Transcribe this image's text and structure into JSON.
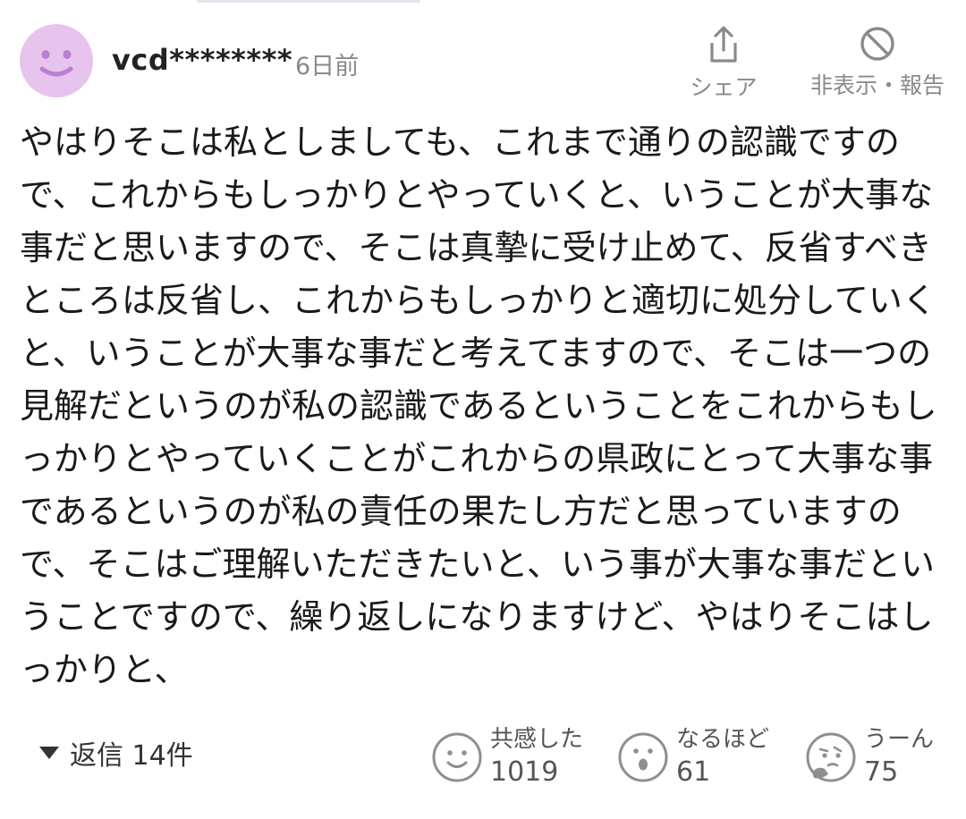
{
  "comment": {
    "username": "vcd********",
    "timestamp": "6日前",
    "body": "やはりそこは私としましても、これまで通りの認識ですので、これからもしっかりとやっていくと、いうことが大事な事だと思いますので、そこは真摯に受け止めて、反省すべきところは反省し、これからもしっかりと適切に処分していくと、いうことが大事な事だと考えてますので、そこは一つの見解だというのが私の認識であるということをこれからもしっかりとやっていくことがこれからの県政にとって大事な事であるというのが私の責任の果たし方だと思っていますので、そこはご理解いただきたいと、いう事が大事な事だということですので、繰り返しになりますけど、やはりそこはしっかりと、"
  },
  "actions": {
    "share_label": "シェア",
    "report_label": "非表示・報告"
  },
  "replies": {
    "label": "返信 14件"
  },
  "reactions": [
    {
      "label": "共感した",
      "count": "1019",
      "icon": "smile-face-icon"
    },
    {
      "label": "なるほど",
      "count": "61",
      "icon": "surprised-face-icon"
    },
    {
      "label": "うーん",
      "count": "75",
      "icon": "thinking-face-icon"
    }
  ],
  "colors": {
    "avatar_bg": "#e7c4ee",
    "avatar_face": "#b97fd0",
    "muted_text": "#8a8a8a"
  }
}
